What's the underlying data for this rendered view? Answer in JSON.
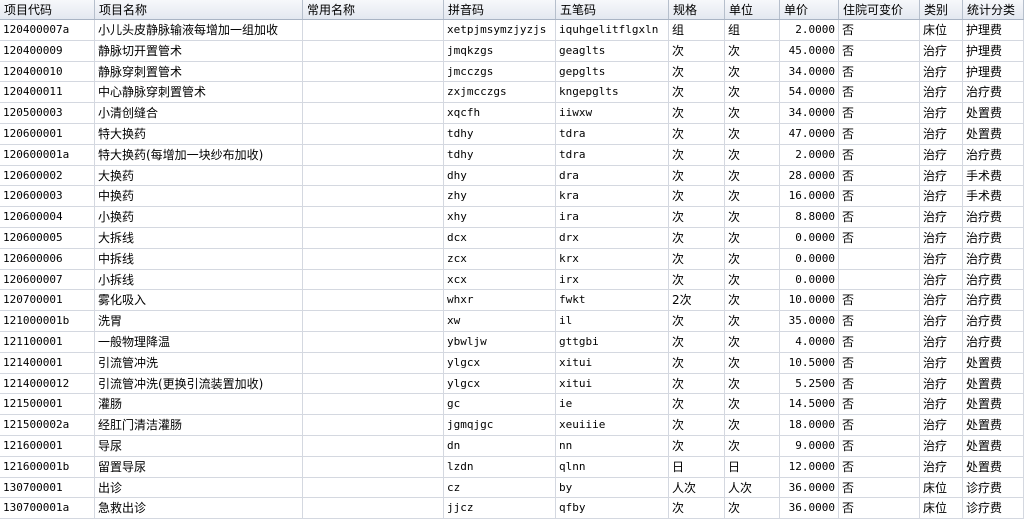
{
  "columns": [
    "项目代码",
    "项目名称",
    "常用名称",
    "拼音码",
    "五笔码",
    "规格",
    "单位",
    "单价",
    "住院可变价",
    "类别",
    "统计分类"
  ],
  "rows": [
    [
      "120400007a",
      "小儿头皮静脉输液每增加一组加收",
      "",
      "xetpjmsymzjyzjs",
      "iquhgelitflgxln",
      "组",
      "组",
      "2.0000",
      "否",
      "床位",
      "护理费"
    ],
    [
      "120400009",
      "静脉切开置管术",
      "",
      "jmqkzgs",
      "geaglts",
      "次",
      "次",
      "45.0000",
      "否",
      "治疗",
      "护理费"
    ],
    [
      "120400010",
      "静脉穿刺置管术",
      "",
      "jmcczgs",
      "gepglts",
      "次",
      "次",
      "34.0000",
      "否",
      "治疗",
      "护理费"
    ],
    [
      "120400011",
      "中心静脉穿刺置管术",
      "",
      "zxjmcczgs",
      "kngepglts",
      "次",
      "次",
      "54.0000",
      "否",
      "治疗",
      "治疗费"
    ],
    [
      "120500003",
      "小清创缝合",
      "",
      "xqcfh",
      "iiwxw",
      "次",
      "次",
      "34.0000",
      "否",
      "治疗",
      "处置费"
    ],
    [
      "120600001",
      "特大换药",
      "",
      "tdhy",
      "tdra",
      "次",
      "次",
      "47.0000",
      "否",
      "治疗",
      "处置费"
    ],
    [
      "120600001a",
      "特大换药(每增加一块纱布加收)",
      "",
      "tdhy",
      "tdra",
      "次",
      "次",
      "2.0000",
      "否",
      "治疗",
      "治疗费"
    ],
    [
      "120600002",
      "大换药",
      "",
      "dhy",
      "dra",
      "次",
      "次",
      "28.0000",
      "否",
      "治疗",
      "手术费"
    ],
    [
      "120600003",
      "中换药",
      "",
      "zhy",
      "kra",
      "次",
      "次",
      "16.0000",
      "否",
      "治疗",
      "手术费"
    ],
    [
      "120600004",
      "小换药",
      "",
      "xhy",
      "ira",
      "次",
      "次",
      "8.8000",
      "否",
      "治疗",
      "治疗费"
    ],
    [
      "120600005",
      "大拆线",
      "",
      "dcx",
      "drx",
      "次",
      "次",
      "0.0000",
      "否",
      "治疗",
      "治疗费"
    ],
    [
      "120600006",
      "中拆线",
      "",
      "zcx",
      "krx",
      "次",
      "次",
      "0.0000",
      "",
      "治疗",
      "治疗费"
    ],
    [
      "120600007",
      "小拆线",
      "",
      "xcx",
      "irx",
      "次",
      "次",
      "0.0000",
      "",
      "治疗",
      "治疗费"
    ],
    [
      "120700001",
      "雾化吸入",
      "",
      "whxr",
      "fwkt",
      "2次",
      "次",
      "10.0000",
      "否",
      "治疗",
      "治疗费"
    ],
    [
      "121000001b",
      "洗胃",
      "",
      "xw",
      "il",
      "次",
      "次",
      "35.0000",
      "否",
      "治疗",
      "治疗费"
    ],
    [
      "121100001",
      "一般物理降温",
      "",
      "ybwljw",
      "gttgbi",
      "次",
      "次",
      "4.0000",
      "否",
      "治疗",
      "治疗费"
    ],
    [
      "121400001",
      "引流管冲洗",
      "",
      "ylgcx",
      "xitui",
      "次",
      "次",
      "10.5000",
      "否",
      "治疗",
      "处置费"
    ],
    [
      "1214000012",
      "引流管冲洗(更换引流装置加收)",
      "",
      "ylgcx",
      "xitui",
      "次",
      "次",
      "5.2500",
      "否",
      "治疗",
      "处置费"
    ],
    [
      "121500001",
      "灌肠",
      "",
      "gc",
      "ie",
      "次",
      "次",
      "14.5000",
      "否",
      "治疗",
      "处置费"
    ],
    [
      "121500002a",
      "经肛门清洁灌肠",
      "",
      "jgmqjgc",
      "xeuiiie",
      "次",
      "次",
      "18.0000",
      "否",
      "治疗",
      "处置费"
    ],
    [
      "121600001",
      "导尿",
      "",
      "dn",
      "nn",
      "次",
      "次",
      "9.0000",
      "否",
      "治疗",
      "处置费"
    ],
    [
      "121600001b",
      "留置导尿",
      "",
      "lzdn",
      "qlnn",
      "日",
      "日",
      "12.0000",
      "否",
      "治疗",
      "处置费"
    ],
    [
      "130700001",
      "出诊",
      "",
      "cz",
      "by",
      "人次",
      "人次",
      "36.0000",
      "否",
      "床位",
      "诊疗费"
    ],
    [
      "130700001a",
      "急救出诊",
      "",
      "jjcz",
      "qfby",
      "次",
      "次",
      "36.0000",
      "否",
      "床位",
      "诊疗费"
    ]
  ]
}
